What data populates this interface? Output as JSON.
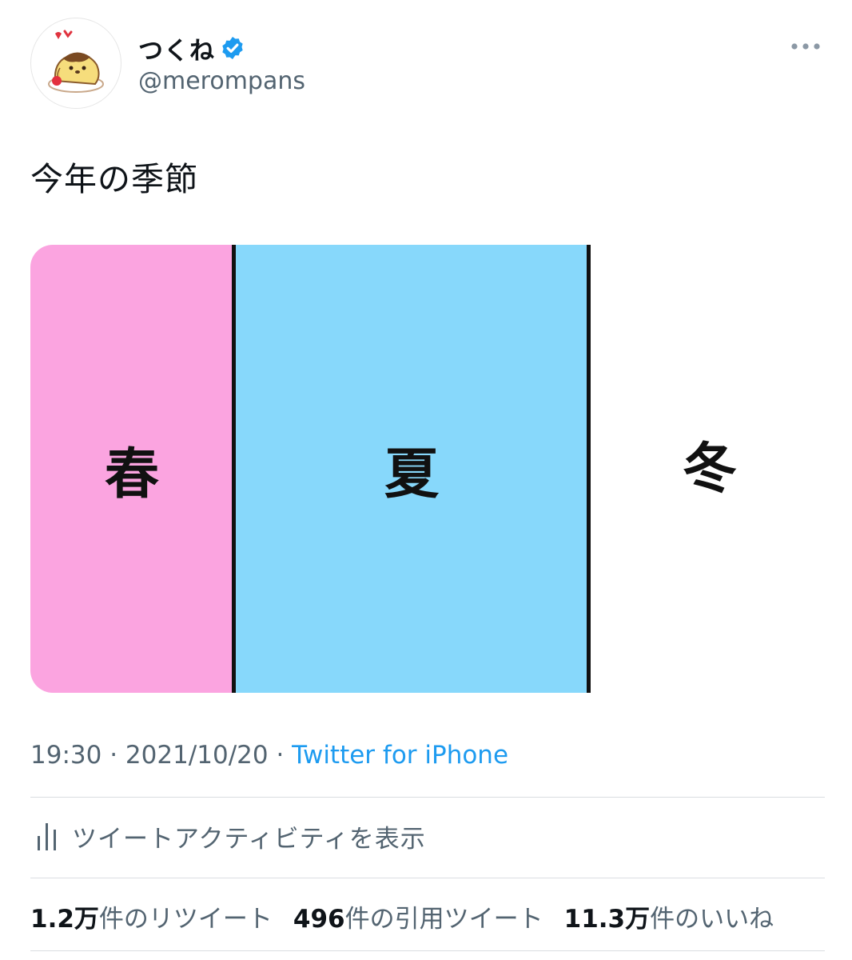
{
  "author": {
    "display_name": "つくね",
    "handle": "@merompans",
    "avatar_icon": "pudding-character-avatar",
    "verified_icon": "verified-badge-icon",
    "verified_color": "#1d9bf0"
  },
  "tweet": {
    "text": "今年の季節",
    "image": {
      "seasons": [
        {
          "label": "春",
          "color": "#fba4e0"
        },
        {
          "label": "夏",
          "color": "#87d8fb"
        },
        {
          "label": "冬",
          "color": "#ffffff"
        }
      ]
    },
    "time": "19:30",
    "separator": " · ",
    "date": "2021/10/20",
    "source": "Twitter for iPhone"
  },
  "activity": {
    "icon": "bar-chart-icon",
    "label": "ツイートアクティビティを表示"
  },
  "stats": {
    "retweets_num": "1.2万",
    "retweets_label": "件のリツイート",
    "quotes_num": "496",
    "quotes_label": "件の引用ツイート",
    "likes_num": "11.3万",
    "likes_label": "件のいいね"
  },
  "colors": {
    "link": "#1d9bf0",
    "secondary_text": "#536471",
    "primary_text": "#0f1419"
  }
}
